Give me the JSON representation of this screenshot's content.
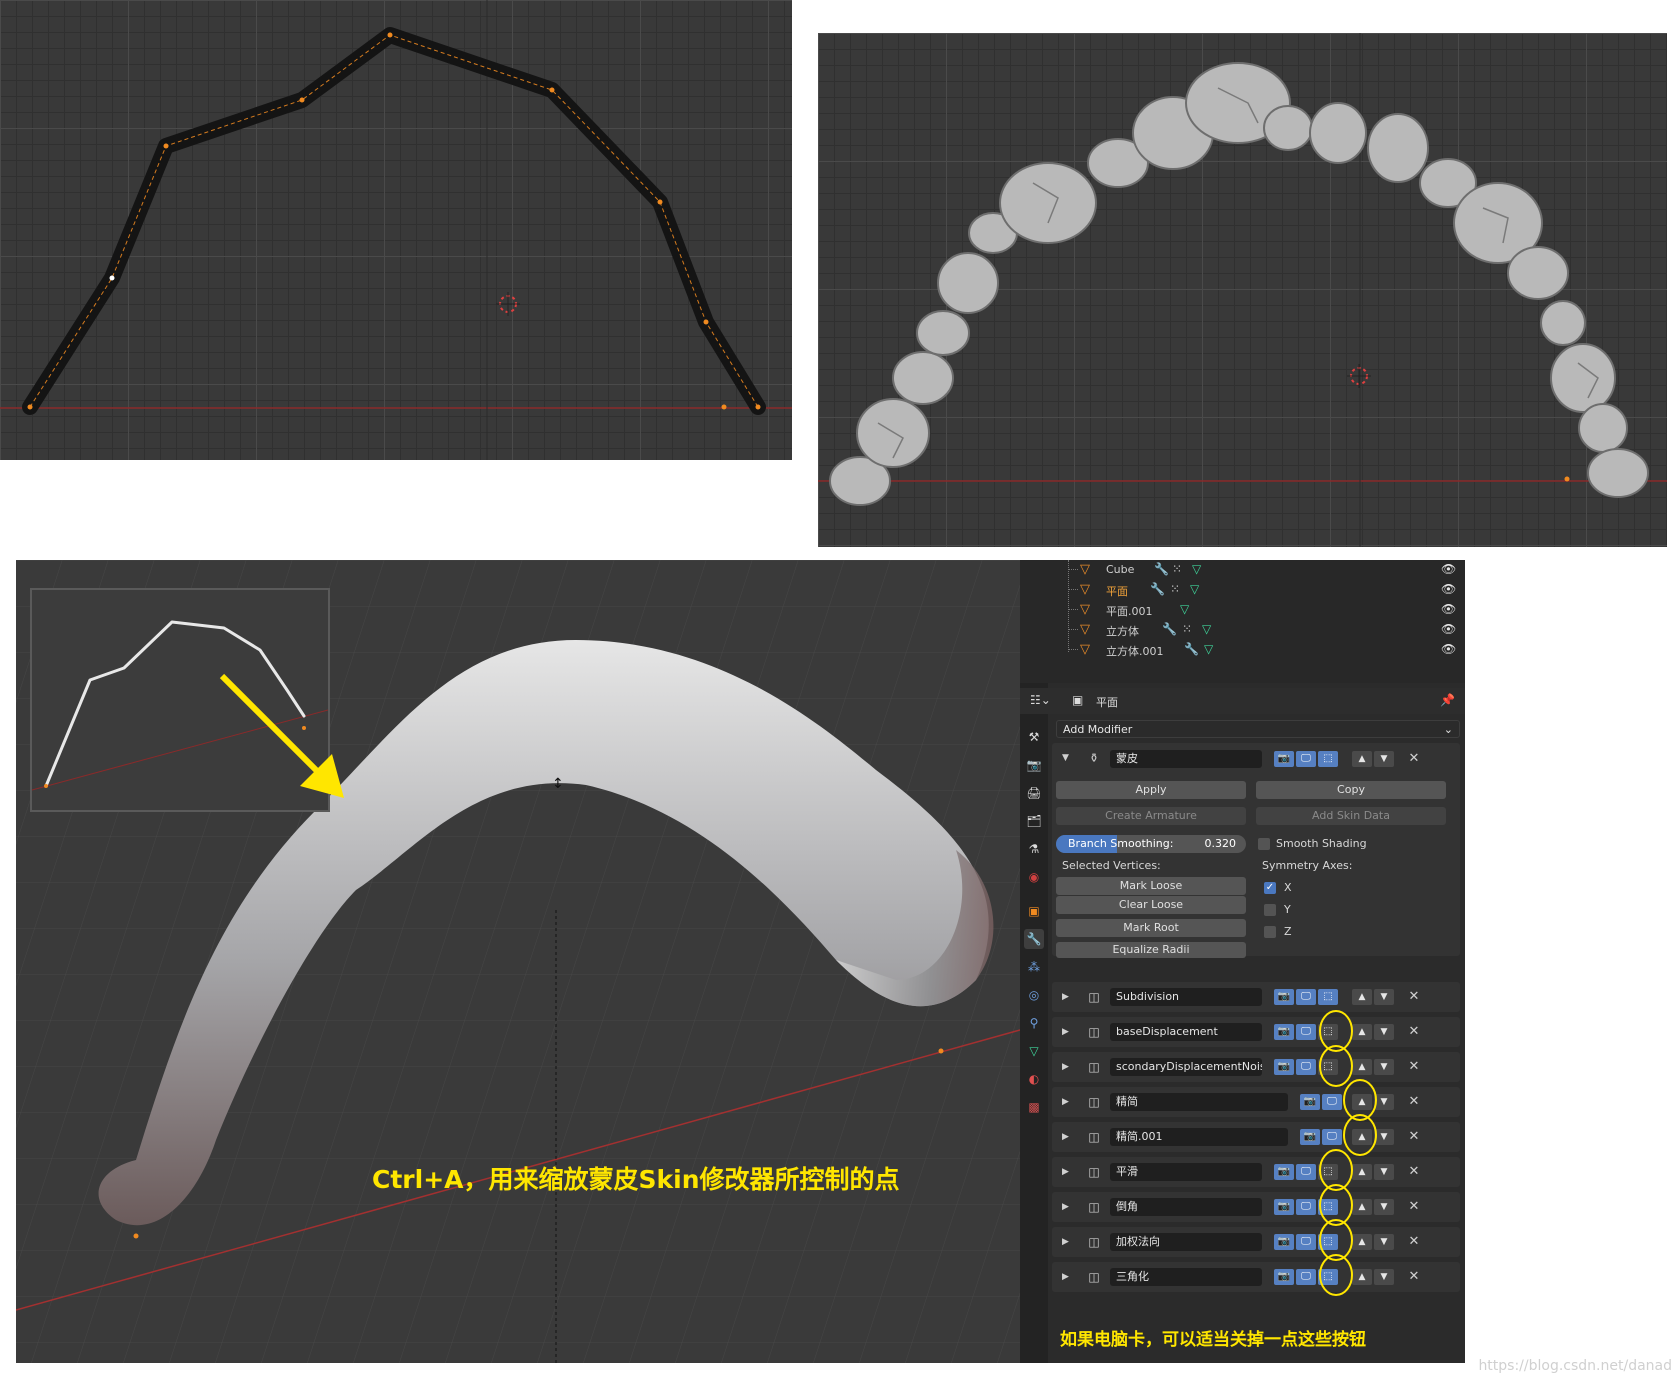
{
  "outliner": {
    "items": [
      {
        "name": "Cube",
        "active": false,
        "has_modifier": true,
        "has_constraint": true
      },
      {
        "name": "平面",
        "active": true,
        "has_modifier": true,
        "has_constraint": true
      },
      {
        "name": "平面.001",
        "active": false,
        "has_modifier": false,
        "has_constraint": false
      },
      {
        "name": "立方体",
        "active": false,
        "has_modifier": true,
        "has_constraint": true
      },
      {
        "name": "立方体.001",
        "active": false,
        "has_modifier": true,
        "has_constraint": false
      }
    ]
  },
  "properties": {
    "object_name": "平面",
    "add_modifier": "Add Modifier",
    "skin": {
      "name": "蒙皮",
      "apply": "Apply",
      "copy": "Copy",
      "create_armature": "Create Armature",
      "add_skin_data": "Add Skin Data",
      "branch_smoothing_label": "Branch Smoothing:",
      "branch_smoothing_value": "0.320",
      "branch_smoothing_fraction": 0.32,
      "smooth_shading": "Smooth Shading",
      "smooth_shading_checked": false,
      "selected_vertices": "Selected Vertices:",
      "symmetry_axes": "Symmetry Axes:",
      "mark_loose": "Mark Loose",
      "clear_loose": "Clear Loose",
      "mark_root": "Mark Root",
      "equalize_radii": "Equalize Radii",
      "axis_x": "X",
      "axis_x_checked": true,
      "axis_y": "Y",
      "axis_y_checked": false,
      "axis_z": "Z",
      "axis_z_checked": false
    },
    "modifiers": [
      {
        "name": "Subdivision",
        "icon": "subdivision-icon",
        "editmode": true
      },
      {
        "name": "baseDisplacement",
        "icon": "displace-icon",
        "editmode": false
      },
      {
        "name": "scondaryDisplacementNoise",
        "icon": "displace-icon",
        "editmode": false
      },
      {
        "name": "精简",
        "icon": "decimate-icon",
        "editmode": null
      },
      {
        "name": "精简.001",
        "icon": "decimate-icon",
        "editmode": null
      },
      {
        "name": "平滑",
        "icon": "smooth-icon",
        "editmode": false
      },
      {
        "name": "倒角",
        "icon": "bevel-icon",
        "editmode": true
      },
      {
        "name": "加权法向",
        "icon": "weighted-normal-icon",
        "editmode": true
      },
      {
        "name": "三角化",
        "icon": "triangulate-icon",
        "editmode": true
      }
    ]
  },
  "captions": {
    "viewport": "Ctrl+A，用来缩放蒙皮Skin修改器所控制的点",
    "panel": "如果电脑卡，可以适当关掉一点这些按钮"
  },
  "watermark": "https://blog.csdn.net/danad",
  "colors": {
    "annotation_yellow": "#ffe600",
    "active_object": "#f0a23a",
    "toggle_blue": "#5680c2",
    "viewport_bg": "#393939",
    "x_axis_red": "#a33030"
  }
}
